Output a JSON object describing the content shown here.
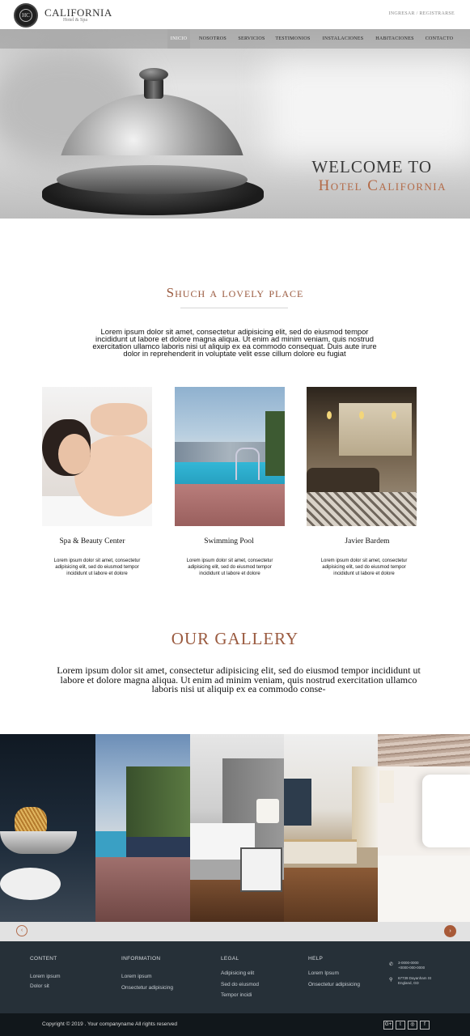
{
  "header": {
    "logo_text": "HC",
    "brand": "CALIFORNIA",
    "brand_sub": "Hotel & Spa",
    "login": "INGRESAR / REGISTRARSE"
  },
  "nav": {
    "items": [
      "INICIO",
      "NOSOTROS",
      "SERVICIOS",
      "TESTIMONIOS",
      "INSTALACIONES",
      "HABITACIONES",
      "CONTACTO"
    ],
    "active": "INICIO"
  },
  "hero": {
    "line1": "WELCOME TO",
    "line2": "Hotel California"
  },
  "section1": {
    "title": "Shuch a lovely place",
    "text": "Lorem ipsum dolor sit amet, consectetur adipisicing elit, sed do eiusmod tempor incididunt ut labore et dolore magna aliqua. Ut enim ad minim veniam, quis nostrud exercitation ullamco laboris nisi ut aliquip ex ea commodo consequat. Duis aute irure dolor in reprehenderit in voluptate velit esse cillum dolore eu fugiat",
    "cards": [
      {
        "title": "Spa & Beauty Center",
        "text": "Lorem ipsum dolor sit amet, consectetur adipisicing elit, sed do eiusmod tempor incididunt ut labore et dolore"
      },
      {
        "title": "Swimming Pool",
        "text": "Lorem ipsum dolor sit amet, consectetur adipisicing elit, sed do eiusmod tempor incididunt ut labore et dolore"
      },
      {
        "title": "Javier Bardem",
        "text": "Lorem ipsum dolor sit amet, consectetur adipisicing elit, sed do eiusmod tempor incididunt ut labore et dolore"
      }
    ]
  },
  "gallery": {
    "title": "OUR GALLERY",
    "text": "Lorem ipsum dolor sit amet, consectetur adipisicing elit, sed do eiusmod tempor incididunt ut labore et dolore magna aliqua. Ut enim ad minim veniam, quis nostrud exercitation ullamco laboris nisi ut aliquip ex ea commodo conse-",
    "prev_icon": "arrow-left-icon",
    "next_icon": "arrow-right-icon"
  },
  "footer": {
    "columns": [
      {
        "heading": "CONTENT",
        "links": [
          "Lorem ipsum",
          "Dolor sit"
        ]
      },
      {
        "heading": "INFORMATION",
        "links": [
          "Lorem ipsum",
          "Onsectetur adipisicing"
        ]
      },
      {
        "heading": "LEGAL",
        "links": [
          "Adipisicing elit",
          "Sed do eiusmod",
          "Tempor incidi"
        ]
      },
      {
        "heading": "HELP",
        "links": [
          "Lorem Ipsum",
          "Onsectetur adipisicing"
        ]
      }
    ],
    "phone_lines": [
      "3-0000-0000",
      "+0000-000-0000"
    ],
    "address_lines": [
      "67739 Dayanham St",
      "England, GD"
    ],
    "copyright": "Copyright © 2019 . Your companyname  All rights reserved",
    "social": [
      "G+",
      "t",
      "◎",
      "f"
    ]
  },
  "colors": {
    "accent": "#a85a38",
    "footer_bg": "#263038",
    "bottom_bg": "#11171b"
  }
}
